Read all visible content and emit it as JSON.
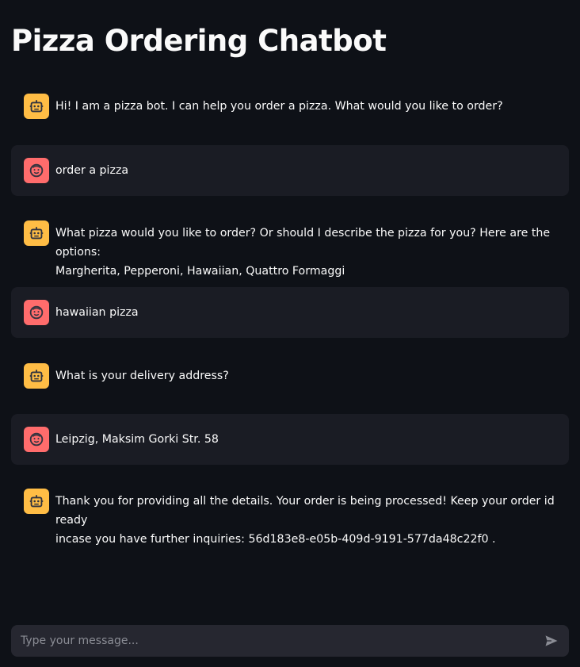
{
  "app": {
    "title": "Pizza Ordering Chatbot"
  },
  "messages": [
    {
      "role": "assistant",
      "avatar": "robot-icon",
      "text": "Hi! I am a pizza bot. I can help you order a pizza. What would you like to order?"
    },
    {
      "role": "user",
      "avatar": "smiling-face-icon",
      "text": "order a pizza"
    },
    {
      "role": "assistant",
      "avatar": "robot-icon",
      "text": "What pizza would you like to order? Or should I describe the pizza for you? Here are the options:\nMargherita, Pepperoni, Hawaiian, Quattro Formaggi"
    },
    {
      "role": "user",
      "avatar": "smiling-face-icon",
      "text": "hawaiian pizza"
    },
    {
      "role": "assistant",
      "avatar": "robot-icon",
      "text": "What is your delivery address?"
    },
    {
      "role": "user",
      "avatar": "smiling-face-icon",
      "text": "Leipzig, Maksim Gorki Str. 58"
    },
    {
      "role": "assistant",
      "avatar": "robot-icon",
      "text": "Thank you for providing all the details. Your order is being processed! Keep your order id ready\nincase you have further inquiries: 56d183e8-e05b-409d-9191-577da48c22f0 ."
    }
  ],
  "chat_input": {
    "placeholder": "Type your message...",
    "value": "",
    "send_icon": "send-icon"
  },
  "colors": {
    "background": "#0e1117",
    "assistant_avatar": "#ffbd45",
    "user_avatar": "#ff6c6c",
    "user_bubble": "#1a1c24",
    "input_background": "#262730"
  }
}
